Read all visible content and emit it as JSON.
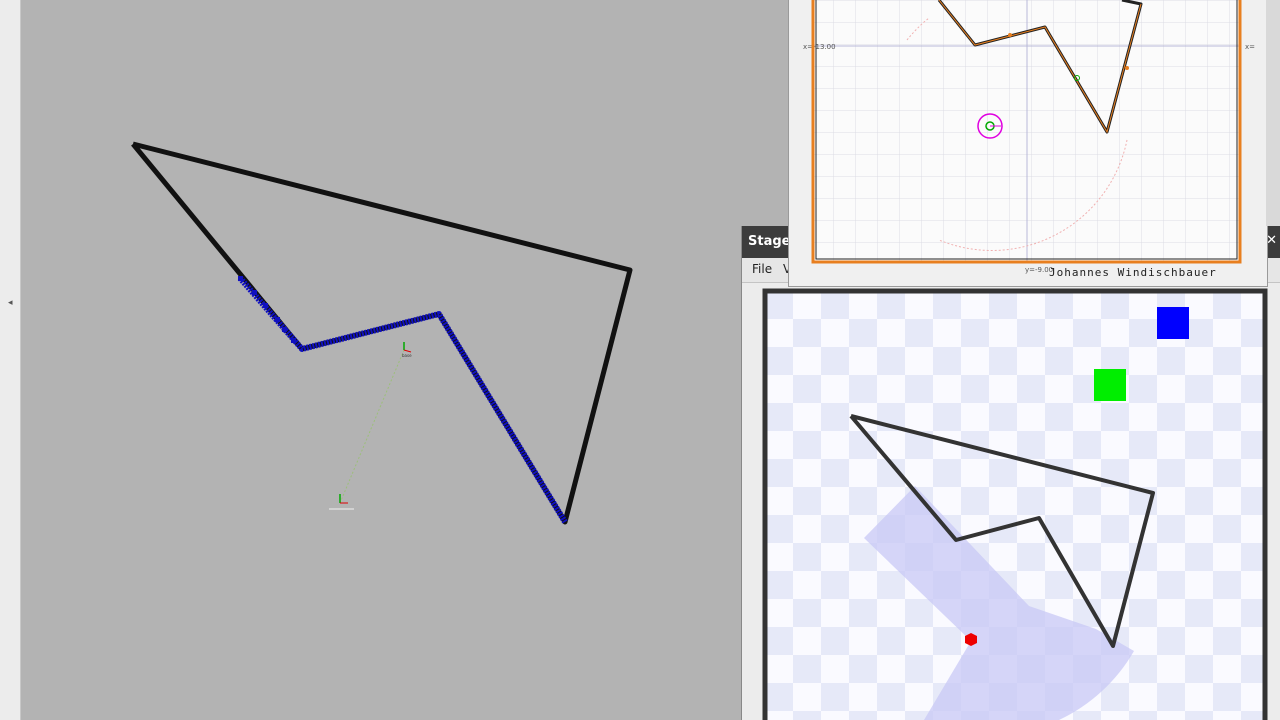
{
  "stage": {
    "title": "Stage",
    "close_glyph": "✕",
    "menu": {
      "file": "File",
      "view": "V"
    }
  },
  "turtle": {
    "label_x_neg": "x=-13.00",
    "label_x_pos": "x=",
    "label_y_neg": "y=-9.00",
    "author": "Johannes Windischbauer"
  },
  "left_strip": {
    "arrow_glyph": "◂"
  },
  "colors": {
    "rviz_bg": "#b3b3b3",
    "wall_black": "#111111",
    "scan_blue": "#1010c0",
    "robot_red": "#ee0000",
    "target_blue": "#0000ff",
    "target_green": "#00ee00",
    "laser_fov": "#c8c8f6",
    "turtle_border": "#e87f1f",
    "goal_magenta": "#e000e0"
  },
  "icons": {
    "stage_close": "close-icon",
    "left_collapse": "collapse-arrow-icon"
  }
}
